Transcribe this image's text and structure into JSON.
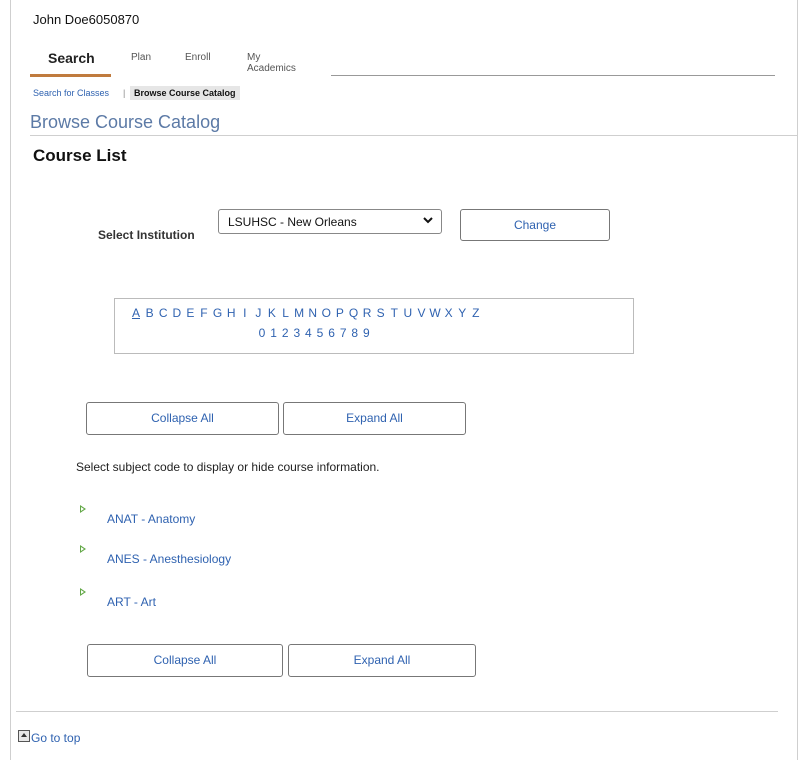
{
  "user": {
    "name": "John Doe6050870"
  },
  "tabs": [
    {
      "label": "Search",
      "active": true
    },
    {
      "label": "Plan",
      "active": false
    },
    {
      "label": "Enroll",
      "active": false
    },
    {
      "label": "My Academics",
      "active": false
    }
  ],
  "breadcrumb": {
    "link": "Search for Classes",
    "separator": "|",
    "current": "Browse Course Catalog"
  },
  "page": {
    "title": "Browse Course Catalog",
    "section_title": "Course List"
  },
  "institution": {
    "label": "Select Institution",
    "selected": "LSUHSC - New Orleans",
    "change_button": "Change"
  },
  "alphabet": {
    "letters": [
      "A",
      "B",
      "C",
      "D",
      "E",
      "F",
      "G",
      "H",
      "I",
      "J",
      "K",
      "L",
      "M",
      "N",
      "O",
      "P",
      "Q",
      "R",
      "S",
      "T",
      "U",
      "V",
      "W",
      "X",
      "Y",
      "Z"
    ],
    "current": "A",
    "digits": [
      "0",
      "1",
      "2",
      "3",
      "4",
      "5",
      "6",
      "7",
      "8",
      "9"
    ]
  },
  "actions": {
    "collapse_all": "Collapse All",
    "expand_all": "Expand All"
  },
  "instruction": "Select subject code to display or hide course information.",
  "subjects": [
    {
      "label": "ANAT - Anatomy"
    },
    {
      "label": "ANES - Anesthesiology"
    },
    {
      "label": "ART - Art"
    }
  ],
  "footer": {
    "go_to_top": "Go to top"
  },
  "colors": {
    "link": "#2f62b0",
    "tab_underline": "#c07b3e",
    "expand_triangle": "#63a847",
    "title": "#5c7aa6"
  }
}
